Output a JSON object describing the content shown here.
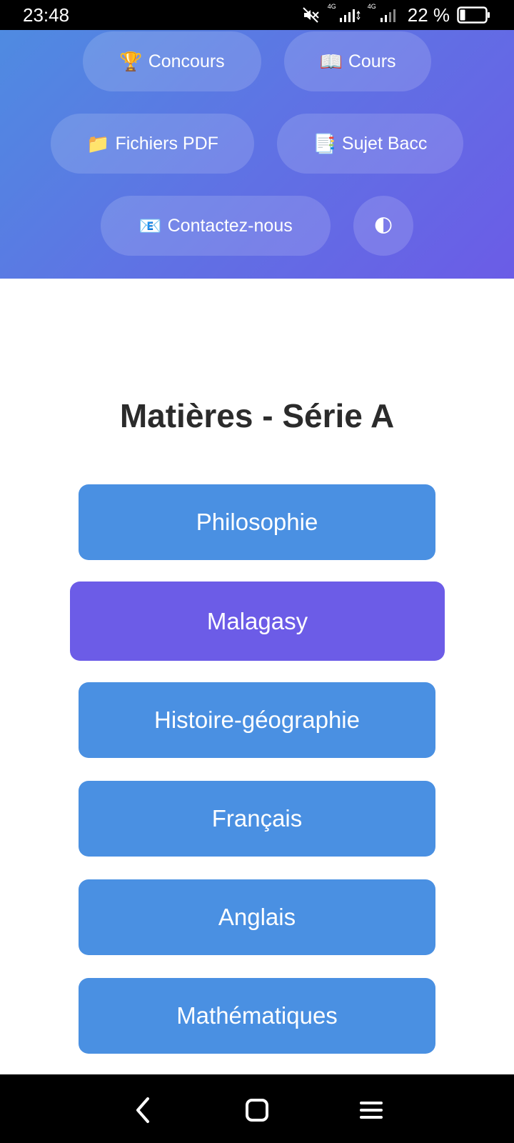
{
  "status_bar": {
    "time": "23:48",
    "network_1": "4G",
    "network_2": "4G",
    "battery_percent": "22 %"
  },
  "nav": {
    "concours": {
      "icon": "🏆",
      "label": "Concours"
    },
    "cours": {
      "icon": "📖",
      "label": "Cours"
    },
    "pdf": {
      "icon": "📁",
      "label": "Fichiers PDF"
    },
    "bacc": {
      "icon": "📑",
      "label": "Sujet Bacc"
    },
    "contact": {
      "icon": "📧",
      "label": "Contactez-nous"
    },
    "theme": {
      "icon": "🌓"
    }
  },
  "main": {
    "title": "Matières - Série A",
    "subjects": [
      {
        "label": "Philosophie"
      },
      {
        "label": "Malagasy"
      },
      {
        "label": "Histoire-géographie"
      },
      {
        "label": "Français"
      },
      {
        "label": "Anglais"
      },
      {
        "label": "Mathématiques"
      }
    ]
  },
  "colors": {
    "subject_button": "#4a90e2",
    "subject_button_active": "#6c5ce7",
    "header_gradient_start": "#4f8be1",
    "header_gradient_end": "#6b5ce6"
  }
}
